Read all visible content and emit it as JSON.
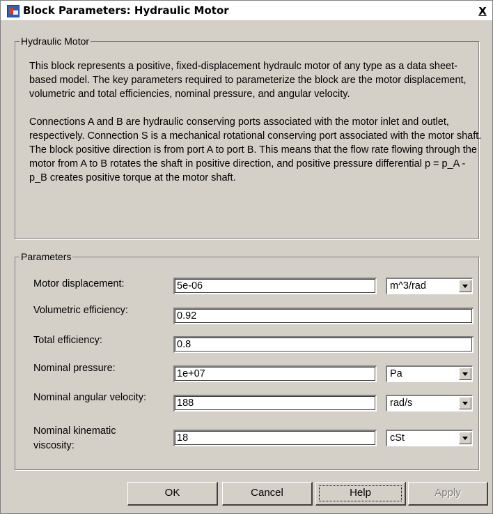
{
  "window": {
    "title": "Block Parameters: Hydraulic Motor",
    "close_label": "X"
  },
  "description": {
    "group_label": "Hydraulic Motor",
    "paragraph1": "This block represents a positive, fixed-displacement hydraulc motor of any type as a data sheet-based model. The key parameters required to parameterize the block are the motor displacement, volumetric and total efficiencies, nominal pressure, and angular velocity.",
    "paragraph2": "Connections A and B are hydraulic conserving ports associated with the motor inlet and outlet, respectively. Connection S is a mechanical rotational conserving port associated with the motor shaft. The block positive direction is from port A to port B. This means that the flow rate flowing through the motor from A to B rotates the shaft in positive direction, and positive pressure differential p = p_A - p_B creates positive torque at the motor shaft."
  },
  "parameters": {
    "group_label": "Parameters",
    "motor_displacement": {
      "label": "Motor displacement:",
      "value": "5e-06",
      "unit": "m^3/rad"
    },
    "volumetric_efficiency": {
      "label": "Volumetric efficiency:",
      "value": "0.92"
    },
    "total_efficiency": {
      "label": "Total efficiency:",
      "value": "0.8"
    },
    "nominal_pressure": {
      "label": "Nominal pressure:",
      "value": "1e+07",
      "unit": "Pa"
    },
    "nominal_angular_velocity": {
      "label": "Nominal angular velocity:",
      "value": "188",
      "unit": "rad/s"
    },
    "nominal_kinematic_viscosity": {
      "label_line1": "Nominal kinematic",
      "label_line2": "viscosity:",
      "value": "18",
      "unit": "cSt"
    }
  },
  "buttons": {
    "ok": "OK",
    "cancel": "Cancel",
    "help": "Help",
    "apply": "Apply"
  },
  "colors": {
    "dialog_background": "#d4d0c8",
    "title_background": "#ffffff",
    "disabled_text": "#808080"
  }
}
